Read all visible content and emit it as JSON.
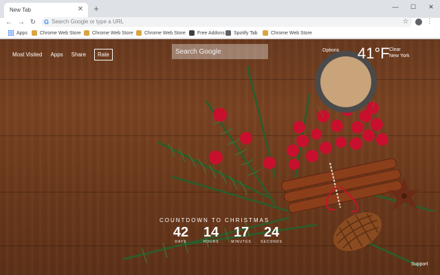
{
  "browser": {
    "tab_title": "New Tab",
    "omnibox_placeholder": "Search Google or type a URL",
    "bookmarks": [
      {
        "label": "Apps"
      },
      {
        "label": "Chrome Web Store"
      },
      {
        "label": "Chrome Web Store"
      },
      {
        "label": "Chrome Web Store"
      },
      {
        "label": "Free Addons"
      },
      {
        "label": "Spotify Tab"
      },
      {
        "label": "Chrome Web Store"
      }
    ]
  },
  "page": {
    "nav_links": [
      "Most Visited",
      "Apps",
      "Share",
      "Rate"
    ],
    "search_placeholder": "Search Google",
    "options_label": "Options",
    "weather": {
      "temperature": "41°F",
      "condition": "Clear",
      "location": "New York"
    },
    "countdown": {
      "title": "COUNTDOWN TO CHRISTMAS",
      "units": [
        {
          "value": "42",
          "label": "DAYS"
        },
        {
          "value": "14",
          "label": "HOURS"
        },
        {
          "value": "17",
          "label": "MINUTES"
        },
        {
          "value": "24",
          "label": "SECONDS"
        }
      ]
    },
    "support_label": "Support"
  },
  "colors": {
    "accent": "#4285f4",
    "wood": "#6a3a1e",
    "berry": "#c8102e",
    "pine": "#2f5a2a"
  }
}
